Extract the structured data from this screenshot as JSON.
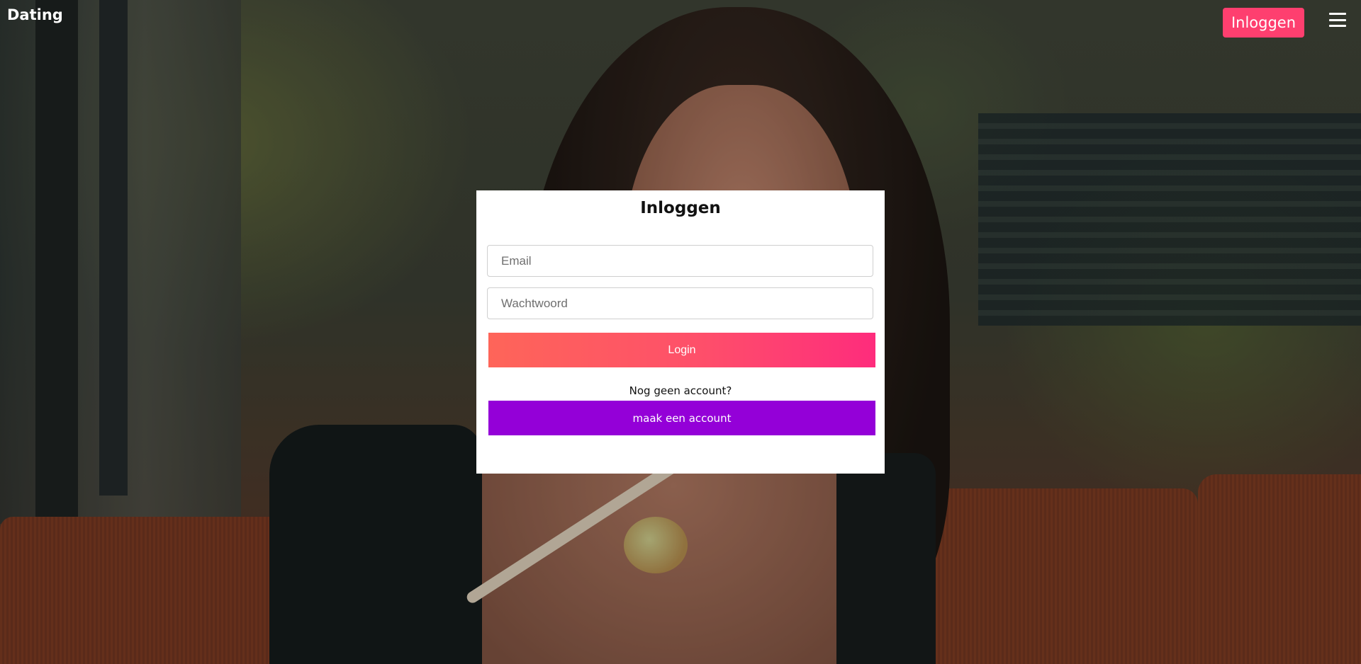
{
  "header": {
    "brand": "Dating",
    "login_button": "Inloggen",
    "menu_icon": "hamburger-menu-icon"
  },
  "login_card": {
    "title": "Inloggen",
    "email_placeholder": "Email",
    "password_placeholder": "Wachtwoord",
    "login_button": "Login",
    "no_account_text": "Nog geen account?",
    "create_account_button": "maak een account"
  },
  "colors": {
    "nav_button": "#fe3f6f",
    "login_gradient_start": "#fe6559",
    "login_gradient_end": "#fe2c7c",
    "create_account": "#9400d8"
  }
}
